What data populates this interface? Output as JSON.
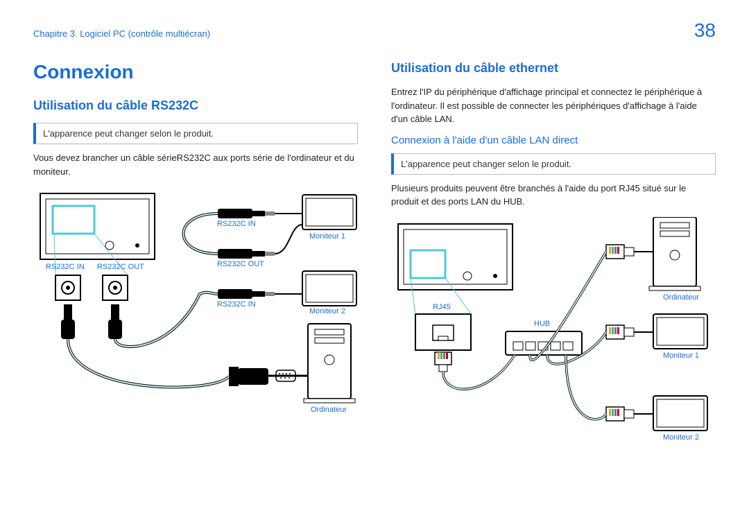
{
  "header": {
    "chapter": "Chapitre 3. Logiciel PC (contrôle multiécran)",
    "page_number": "38"
  },
  "left": {
    "h1": "Connexion",
    "h2": "Utilisation du câble RS232C",
    "note": "L'apparence peut changer selon le produit.",
    "body": "Vous devez brancher un câble sérieRS232C aux ports série de l'ordinateur et du moniteur.",
    "labels": {
      "rs232c_in_top": "RS232C IN",
      "rs232c_out_top": "RS232C OUT",
      "rs232c_in_mid": "RS232C IN",
      "rs232c_out_mid": "RS232C OUT",
      "rs232c_in_low": "RS232C IN",
      "moniteur1": "Moniteur 1",
      "moniteur2": "Moniteur 2",
      "ordinateur": "Ordinateur"
    }
  },
  "right": {
    "h2": "Utilisation du câble ethernet",
    "body1": "Entrez l'IP du périphérique d'affichage principal et connectez le périphérique à l'ordinateur. Il est possible de connecter les périphériques d'affichage à l'aide d'un câble LAN.",
    "h3": "Connexion à l'aide d'un câble LAN direct",
    "note": "L'apparence peut changer selon le produit.",
    "body2": "Plusieurs produits peuvent être branchés à l'aide du port RJ45 situé sur le produit et des ports LAN du HUB.",
    "labels": {
      "rj45": "RJ45",
      "hub": "HUB",
      "ordinateur": "Ordinateur",
      "moniteur1": "Moniteur 1",
      "moniteur2": "Moniteur 2"
    }
  }
}
